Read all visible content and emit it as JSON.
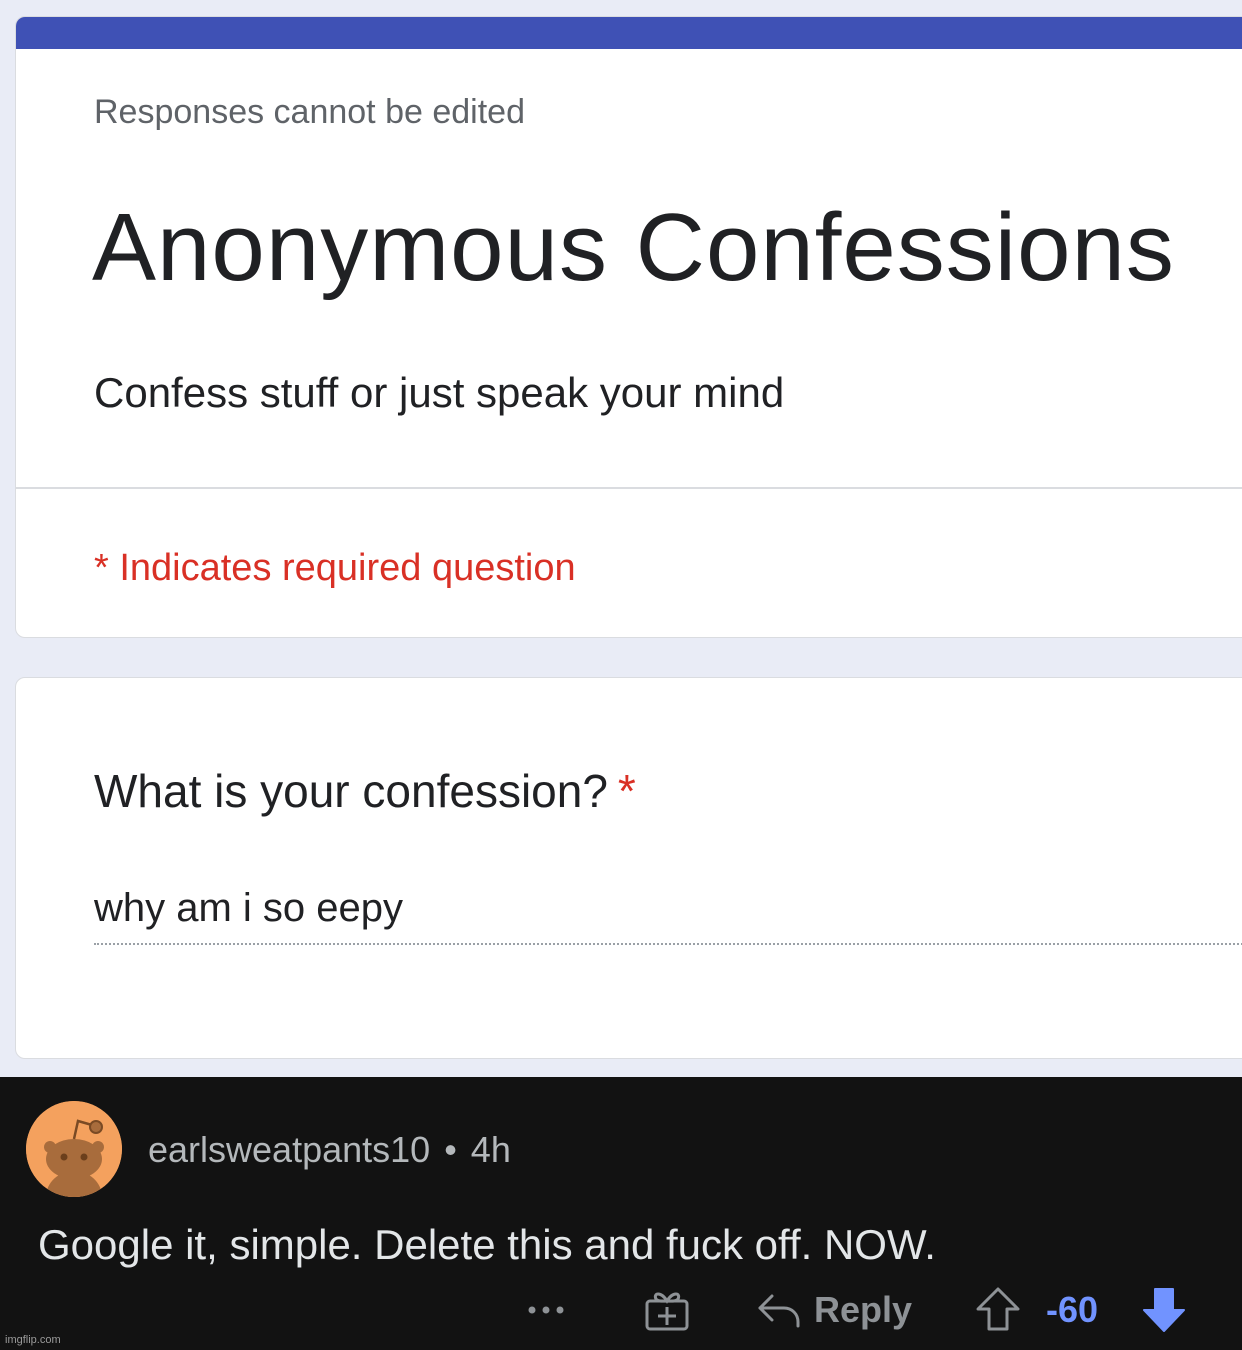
{
  "form": {
    "edit_notice": "Responses cannot be edited",
    "title": "Anonymous Confessions",
    "description": "Confess stuff or just speak your mind",
    "required_notice": "* Indicates required question",
    "accent_color": "#3f51b5",
    "required_color": "#d93025"
  },
  "question": {
    "label": "What is your confession?",
    "required_marker": "*",
    "answer": "why am i so eepy"
  },
  "comment": {
    "username": "earlsweatpants10",
    "separator": "•",
    "age": "4h",
    "text": "Google it, simple. Delete this and fuck off. NOW.",
    "more_icon": "more-options-icon",
    "award_icon": "award-icon",
    "reply_label": "Reply",
    "score": "-60",
    "vote_state": "downvoted",
    "vote_color": "#7193ff"
  },
  "watermark": "imgflip.com"
}
